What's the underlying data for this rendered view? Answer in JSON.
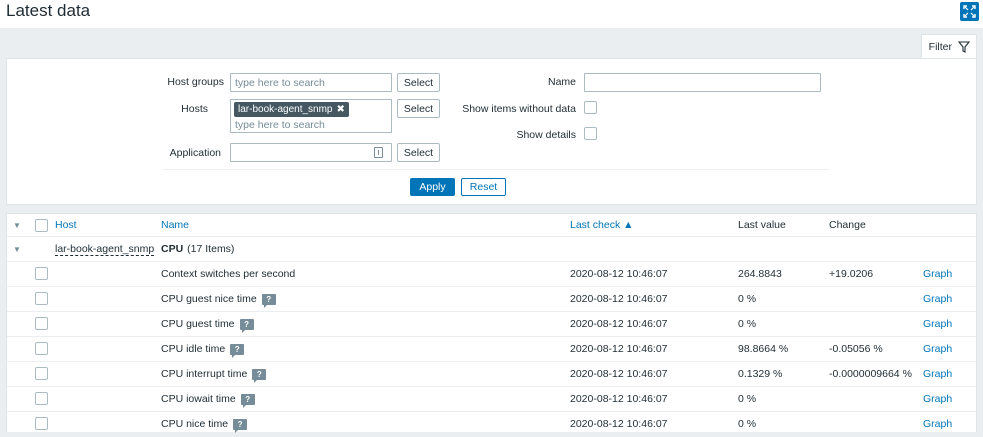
{
  "page": {
    "title": "Latest data"
  },
  "filter": {
    "tab_label": "Filter",
    "host_groups": {
      "label": "Host groups",
      "placeholder": "type here to search",
      "select_label": "Select"
    },
    "hosts": {
      "label": "Hosts",
      "selected_tag": "lar-book-agent_snmp",
      "placeholder": "type here to search",
      "select_label": "Select"
    },
    "application": {
      "label": "Application",
      "value": "",
      "select_label": "Select"
    },
    "name": {
      "label": "Name",
      "value": ""
    },
    "show_items_without_data": {
      "label": "Show items without data",
      "checked": false
    },
    "show_details": {
      "label": "Show details",
      "checked": false
    },
    "apply_label": "Apply",
    "reset_label": "Reset"
  },
  "table": {
    "headers": {
      "host": "Host",
      "name": "Name",
      "last_check": "Last check ▲",
      "last_value": "Last value",
      "change": "Change"
    },
    "group": {
      "host": "lar-book-agent_snmp",
      "app_name": "CPU",
      "app_count": "(17 Items)"
    },
    "rows": [
      {
        "name": "Context switches per second",
        "hint": false,
        "last_check": "2020-08-12 10:46:07",
        "last_value": "264.8843",
        "change": "+19.0206",
        "action": "Graph"
      },
      {
        "name": "CPU guest nice time",
        "hint": true,
        "last_check": "2020-08-12 10:46:07",
        "last_value": "0 %",
        "change": "",
        "action": "Graph"
      },
      {
        "name": "CPU guest time",
        "hint": true,
        "last_check": "2020-08-12 10:46:07",
        "last_value": "0 %",
        "change": "",
        "action": "Graph"
      },
      {
        "name": "CPU idle time",
        "hint": true,
        "last_check": "2020-08-12 10:46:07",
        "last_value": "98.8664 %",
        "change": "-0.05056 %",
        "action": "Graph"
      },
      {
        "name": "CPU interrupt time",
        "hint": true,
        "last_check": "2020-08-12 10:46:07",
        "last_value": "0.1329 %",
        "change": "-0.0000009664 %",
        "action": "Graph"
      },
      {
        "name": "CPU iowait time",
        "hint": true,
        "last_check": "2020-08-12 10:46:07",
        "last_value": "0 %",
        "change": "",
        "action": "Graph"
      },
      {
        "name": "CPU nice time",
        "hint": true,
        "last_check": "2020-08-12 10:46:07",
        "last_value": "0 %",
        "change": "",
        "action": "Graph"
      }
    ]
  },
  "colors": {
    "accent": "#0275b8",
    "background": "#ebeef0",
    "text": "#1f2c33"
  },
  "icons": {
    "fullscreen": "fullscreen-icon",
    "filter": "funnel-icon",
    "hint": "question-icon"
  }
}
